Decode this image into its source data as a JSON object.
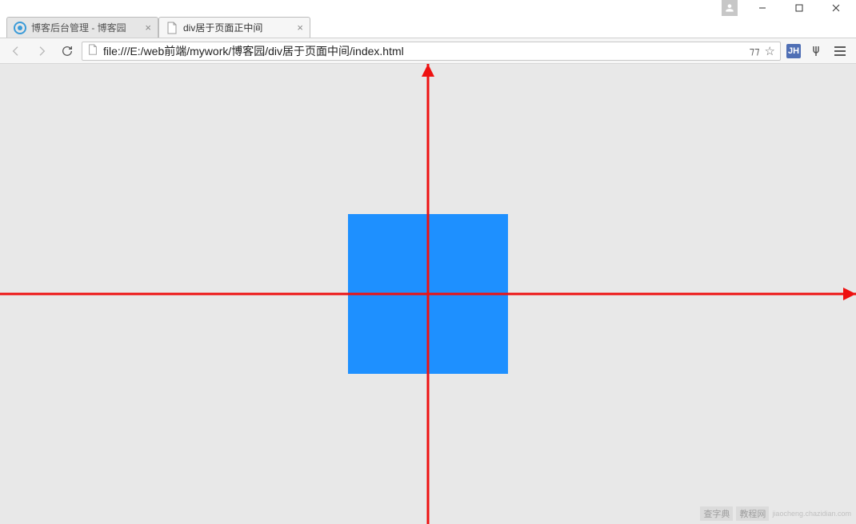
{
  "window": {
    "controls": {
      "minimize": "—",
      "maximize": "▢",
      "close": "✕"
    }
  },
  "tabs": [
    {
      "title": "博客后台管理 - 博客园",
      "favicon": "cnblogs",
      "active": false
    },
    {
      "title": "div居于页面正中间",
      "favicon": "file",
      "active": true
    }
  ],
  "addressbar": {
    "url": "file:///E:/web前端/mywork/博客园/div居于页面中间/index.html",
    "translate_icon": "translate",
    "star_icon": "star"
  },
  "extensions": {
    "jh_label": "JH",
    "pitchfork_icon": "pitchfork"
  },
  "content": {
    "box_color": "#1e90ff",
    "axis_color": "#e11",
    "bg_color": "#e8e8e8"
  },
  "watermark": {
    "label1": "查字典",
    "label2": "教程网",
    "url": "jiaocheng.chazidian.com"
  }
}
